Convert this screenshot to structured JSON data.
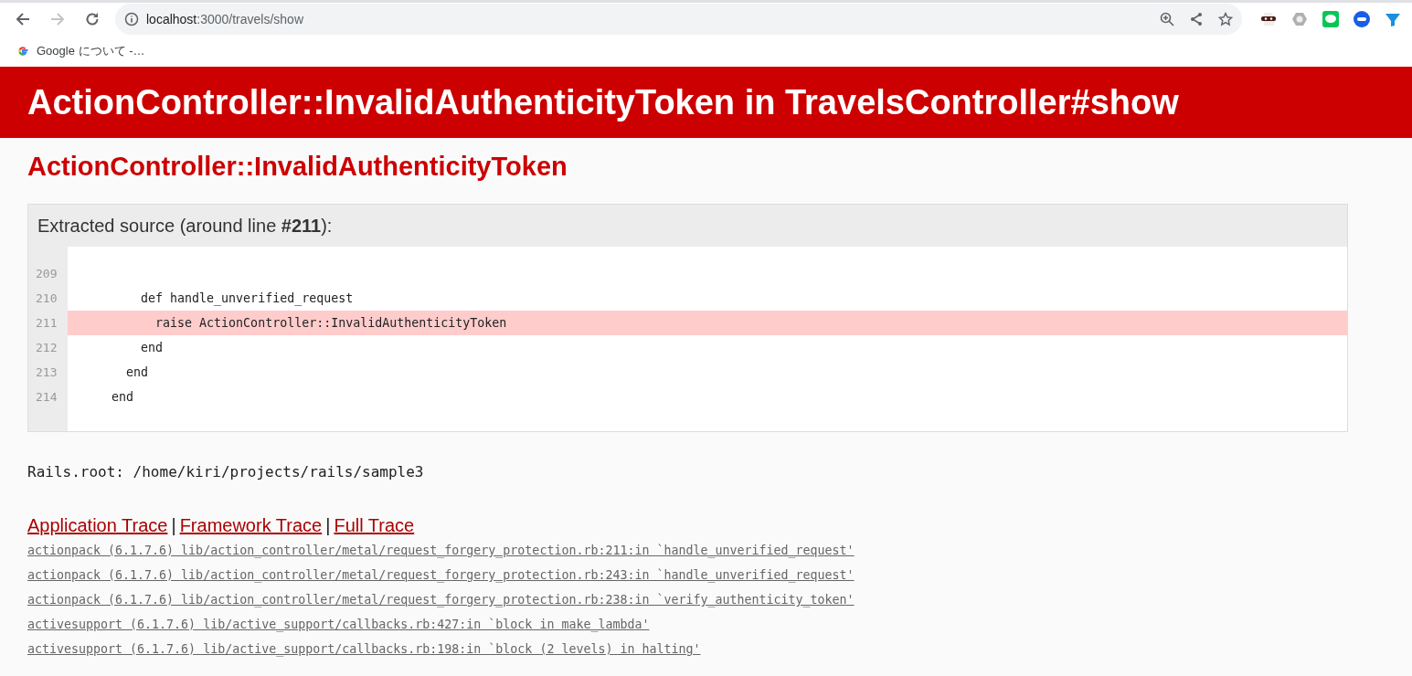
{
  "browser": {
    "back_enabled": true,
    "forward_enabled": false,
    "url_host": "localhost",
    "url_path": ":3000/travels/show",
    "bookmarks": [
      {
        "label": "Google について -…"
      }
    ]
  },
  "header": {
    "title": "ActionController::InvalidAuthenticityToken in TravelsController#show"
  },
  "error_name": "ActionController::InvalidAuthenticityToken",
  "source": {
    "heading": "Extracted source (around line **#211**):",
    "lines": [
      {
        "number": "209",
        "selected": false
      },
      {
        "number": "210",
        "code": "        def handle_unverified_request",
        "selected": false
      },
      {
        "number": "211",
        "code": "          raise ActionController::InvalidAuthenticityToken",
        "selected": true
      },
      {
        "number": "212",
        "code": "        end",
        "selected": false
      },
      {
        "number": "213",
        "code": "      end",
        "selected": false
      },
      {
        "number": "214",
        "code": "    end",
        "selected": false
      }
    ]
  },
  "rails_root": "Rails.root: /home/kiri/projects/rails/sample3",
  "trace_links": [
    "Application Trace",
    "Framework Trace",
    "Full Trace"
  ],
  "trace_separator": "|",
  "trace": [
    "actionpack (6.1.7.6) lib/action_controller/metal/request_forgery_protection.rb:211:in `handle_unverified_request'",
    "actionpack (6.1.7.6) lib/action_controller/metal/request_forgery_protection.rb:243:in `handle_unverified_request'",
    "actionpack (6.1.7.6) lib/action_controller/metal/request_forgery_protection.rb:238:in `verify_authenticity_token'",
    "activesupport (6.1.7.6) lib/active_support/callbacks.rb:427:in `block in make_lambda'",
    "activesupport (6.1.7.6) lib/active_support/callbacks.rb:198:in `block (2 levels) in halting'"
  ]
}
